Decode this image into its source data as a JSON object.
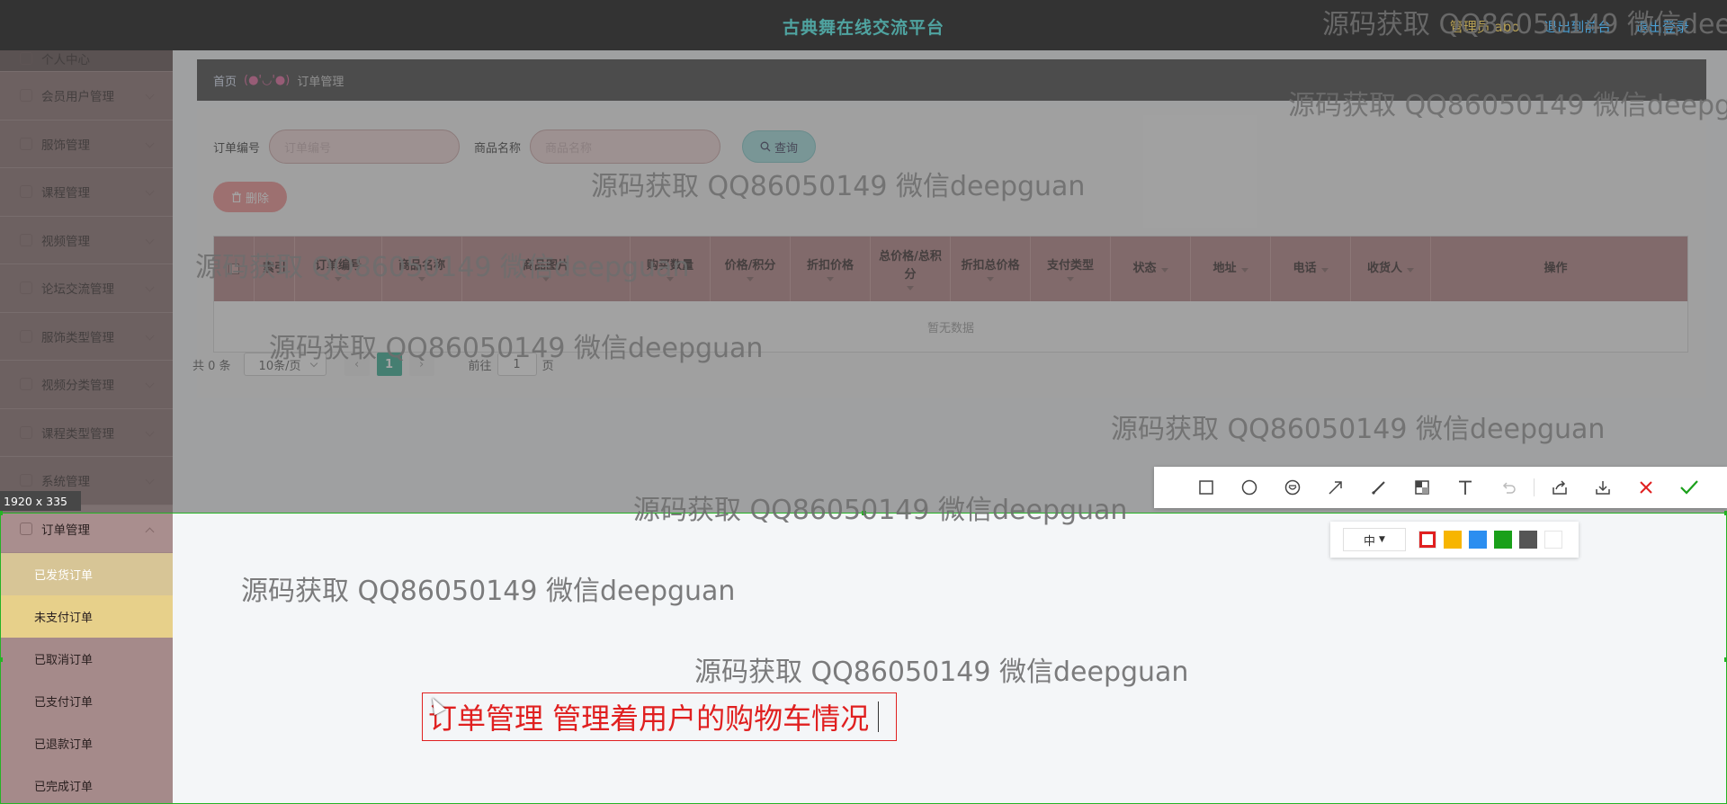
{
  "topbar": {
    "title": "古典舞在线交流平台",
    "admin_label": "管理员 abo",
    "back_label": "退出到前台",
    "logout_label": "退出登录"
  },
  "sidebar": {
    "first_item": "个人中心",
    "items": [
      "会员用户管理",
      "服饰管理",
      "课程管理",
      "视频管理",
      "论坛交流管理",
      "服饰类型管理",
      "视频分类管理",
      "课程类型管理",
      "系统管理",
      "订单管理"
    ],
    "sub_items": [
      "已发货订单",
      "未支付订单",
      "已取消订单",
      "已支付订单",
      "已退款订单",
      "已完成订单"
    ]
  },
  "breadcrumb": {
    "home": "首页",
    "face": "(●'◡'●)",
    "current": "订单管理"
  },
  "search": {
    "order_no_label": "订单编号",
    "order_no_placeholder": "订单编号",
    "product_label": "商品名称",
    "product_placeholder": "商品名称",
    "query_button": "查询"
  },
  "delete_button": "删除",
  "table": {
    "headers": [
      "索引",
      "订单编号",
      "商品名称",
      "商品图片",
      "购买数量",
      "价格/积分",
      "折扣价格",
      "总价格/总积分",
      "折扣总价格",
      "支付类型",
      "状态",
      "地址",
      "电话",
      "收货人",
      "操作"
    ],
    "empty_text": "暂无数据"
  },
  "pager": {
    "total": "共 0 条",
    "page_size": "10条/页",
    "current_page": "1",
    "goto_label": "前往",
    "goto_value": "1",
    "page_unit": "页"
  },
  "screenshot": {
    "size_label": "1920 x 335",
    "font_size": "中",
    "annotation_text": "订单管理 管理着用户的购物车情况",
    "colors": [
      "#e02020",
      "#f7b500",
      "#2b8ef0",
      "#1aa01a",
      "#555555",
      "#ffffff"
    ]
  },
  "watermark": "源码获取 QQ86050149 微信deepguan"
}
